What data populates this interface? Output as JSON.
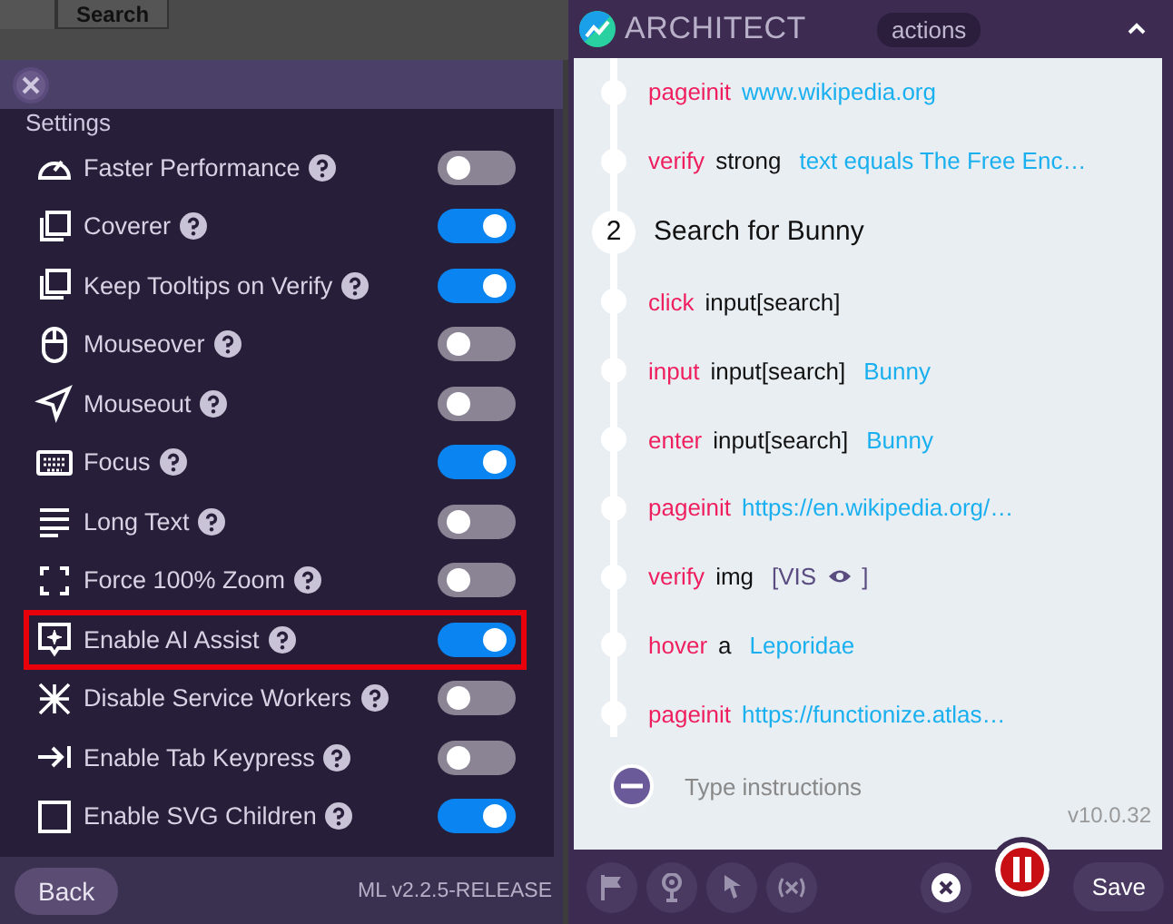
{
  "background": {
    "search_button": "Search"
  },
  "settings_panel": {
    "heading": "Settings",
    "items": [
      {
        "label": "Faster Performance",
        "on": false,
        "highlighted": false
      },
      {
        "label": "Coverer",
        "on": true,
        "highlighted": false
      },
      {
        "label": "Keep Tooltips on Verify",
        "on": true,
        "highlighted": false
      },
      {
        "label": "Mouseover",
        "on": false,
        "highlighted": false
      },
      {
        "label": "Mouseout",
        "on": false,
        "highlighted": false
      },
      {
        "label": "Focus",
        "on": true,
        "highlighted": false
      },
      {
        "label": "Long Text",
        "on": false,
        "highlighted": false
      },
      {
        "label": "Force 100% Zoom",
        "on": false,
        "highlighted": false
      },
      {
        "label": "Enable AI Assist",
        "on": true,
        "highlighted": true
      },
      {
        "label": "Disable Service Workers",
        "on": false,
        "highlighted": false
      },
      {
        "label": "Enable Tab Keypress",
        "on": false,
        "highlighted": false
      },
      {
        "label": "Enable SVG Children",
        "on": true,
        "highlighted": false
      }
    ],
    "back_button": "Back",
    "version": "ML v2.2.5-RELEASE"
  },
  "architect": {
    "title": "ARCHITECT",
    "mode": "actions",
    "steps": [
      {
        "kind": "step",
        "action": "pageinit",
        "value": "www.wikipedia.org"
      },
      {
        "kind": "step",
        "action": "verify",
        "target": "strong",
        "value": "text equals The Free Enc…"
      },
      {
        "kind": "group",
        "number": "2",
        "title": "Search for Bunny"
      },
      {
        "kind": "step",
        "action": "click",
        "target": "input[search]"
      },
      {
        "kind": "step",
        "action": "input",
        "target": "input[search]",
        "value": "Bunny"
      },
      {
        "kind": "step",
        "action": "enter",
        "target": "input[search]",
        "value": "Bunny"
      },
      {
        "kind": "step",
        "action": "pageinit",
        "value": "https://en.wikipedia.org/…"
      },
      {
        "kind": "step",
        "action": "verify",
        "target": "img",
        "badge": "[VIS",
        "badge_end": "]"
      },
      {
        "kind": "step",
        "action": "hover",
        "target": "a",
        "value": "Leporidae"
      },
      {
        "kind": "step",
        "action": "pageinit",
        "value": "https://functionize.atlas…"
      }
    ],
    "input_placeholder": "Type instructions",
    "version": "v10.0.32",
    "save_button": "Save"
  }
}
